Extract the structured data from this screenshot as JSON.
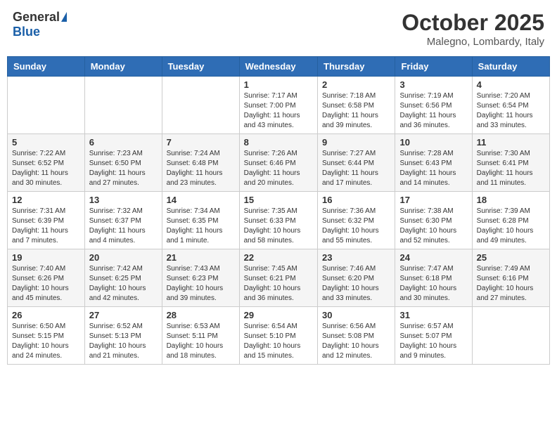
{
  "header": {
    "logo_general": "General",
    "logo_blue": "Blue",
    "month_title": "October 2025",
    "location": "Malegno, Lombardy, Italy"
  },
  "days_of_week": [
    "Sunday",
    "Monday",
    "Tuesday",
    "Wednesday",
    "Thursday",
    "Friday",
    "Saturday"
  ],
  "weeks": [
    [
      {
        "day": "",
        "info": ""
      },
      {
        "day": "",
        "info": ""
      },
      {
        "day": "",
        "info": ""
      },
      {
        "day": "1",
        "info": "Sunrise: 7:17 AM\nSunset: 7:00 PM\nDaylight: 11 hours and 43 minutes."
      },
      {
        "day": "2",
        "info": "Sunrise: 7:18 AM\nSunset: 6:58 PM\nDaylight: 11 hours and 39 minutes."
      },
      {
        "day": "3",
        "info": "Sunrise: 7:19 AM\nSunset: 6:56 PM\nDaylight: 11 hours and 36 minutes."
      },
      {
        "day": "4",
        "info": "Sunrise: 7:20 AM\nSunset: 6:54 PM\nDaylight: 11 hours and 33 minutes."
      }
    ],
    [
      {
        "day": "5",
        "info": "Sunrise: 7:22 AM\nSunset: 6:52 PM\nDaylight: 11 hours and 30 minutes."
      },
      {
        "day": "6",
        "info": "Sunrise: 7:23 AM\nSunset: 6:50 PM\nDaylight: 11 hours and 27 minutes."
      },
      {
        "day": "7",
        "info": "Sunrise: 7:24 AM\nSunset: 6:48 PM\nDaylight: 11 hours and 23 minutes."
      },
      {
        "day": "8",
        "info": "Sunrise: 7:26 AM\nSunset: 6:46 PM\nDaylight: 11 hours and 20 minutes."
      },
      {
        "day": "9",
        "info": "Sunrise: 7:27 AM\nSunset: 6:44 PM\nDaylight: 11 hours and 17 minutes."
      },
      {
        "day": "10",
        "info": "Sunrise: 7:28 AM\nSunset: 6:43 PM\nDaylight: 11 hours and 14 minutes."
      },
      {
        "day": "11",
        "info": "Sunrise: 7:30 AM\nSunset: 6:41 PM\nDaylight: 11 hours and 11 minutes."
      }
    ],
    [
      {
        "day": "12",
        "info": "Sunrise: 7:31 AM\nSunset: 6:39 PM\nDaylight: 11 hours and 7 minutes."
      },
      {
        "day": "13",
        "info": "Sunrise: 7:32 AM\nSunset: 6:37 PM\nDaylight: 11 hours and 4 minutes."
      },
      {
        "day": "14",
        "info": "Sunrise: 7:34 AM\nSunset: 6:35 PM\nDaylight: 11 hours and 1 minute."
      },
      {
        "day": "15",
        "info": "Sunrise: 7:35 AM\nSunset: 6:33 PM\nDaylight: 10 hours and 58 minutes."
      },
      {
        "day": "16",
        "info": "Sunrise: 7:36 AM\nSunset: 6:32 PM\nDaylight: 10 hours and 55 minutes."
      },
      {
        "day": "17",
        "info": "Sunrise: 7:38 AM\nSunset: 6:30 PM\nDaylight: 10 hours and 52 minutes."
      },
      {
        "day": "18",
        "info": "Sunrise: 7:39 AM\nSunset: 6:28 PM\nDaylight: 10 hours and 49 minutes."
      }
    ],
    [
      {
        "day": "19",
        "info": "Sunrise: 7:40 AM\nSunset: 6:26 PM\nDaylight: 10 hours and 45 minutes."
      },
      {
        "day": "20",
        "info": "Sunrise: 7:42 AM\nSunset: 6:25 PM\nDaylight: 10 hours and 42 minutes."
      },
      {
        "day": "21",
        "info": "Sunrise: 7:43 AM\nSunset: 6:23 PM\nDaylight: 10 hours and 39 minutes."
      },
      {
        "day": "22",
        "info": "Sunrise: 7:45 AM\nSunset: 6:21 PM\nDaylight: 10 hours and 36 minutes."
      },
      {
        "day": "23",
        "info": "Sunrise: 7:46 AM\nSunset: 6:20 PM\nDaylight: 10 hours and 33 minutes."
      },
      {
        "day": "24",
        "info": "Sunrise: 7:47 AM\nSunset: 6:18 PM\nDaylight: 10 hours and 30 minutes."
      },
      {
        "day": "25",
        "info": "Sunrise: 7:49 AM\nSunset: 6:16 PM\nDaylight: 10 hours and 27 minutes."
      }
    ],
    [
      {
        "day": "26",
        "info": "Sunrise: 6:50 AM\nSunset: 5:15 PM\nDaylight: 10 hours and 24 minutes."
      },
      {
        "day": "27",
        "info": "Sunrise: 6:52 AM\nSunset: 5:13 PM\nDaylight: 10 hours and 21 minutes."
      },
      {
        "day": "28",
        "info": "Sunrise: 6:53 AM\nSunset: 5:11 PM\nDaylight: 10 hours and 18 minutes."
      },
      {
        "day": "29",
        "info": "Sunrise: 6:54 AM\nSunset: 5:10 PM\nDaylight: 10 hours and 15 minutes."
      },
      {
        "day": "30",
        "info": "Sunrise: 6:56 AM\nSunset: 5:08 PM\nDaylight: 10 hours and 12 minutes."
      },
      {
        "day": "31",
        "info": "Sunrise: 6:57 AM\nSunset: 5:07 PM\nDaylight: 10 hours and 9 minutes."
      },
      {
        "day": "",
        "info": ""
      }
    ]
  ]
}
